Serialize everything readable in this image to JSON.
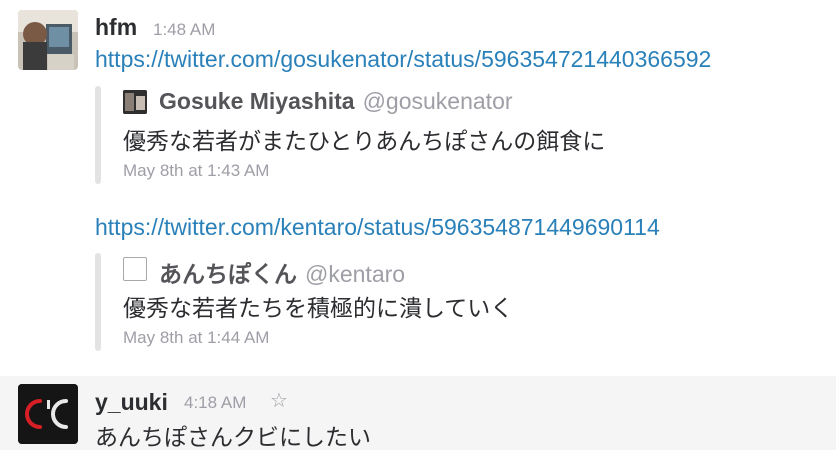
{
  "messages": [
    {
      "author": "hfm",
      "time": "1:48 AM",
      "links": [
        {
          "url": "https://twitter.com/gosukenator/status/596354721440366592",
          "attachment": {
            "author_name": "Gosuke Miyashita",
            "handle": "@gosukenator",
            "text": "優秀な若者がまたひとりあんちぽさんの餌食に",
            "timestamp": "May 8th at 1:43 AM",
            "icon": "user-avatar-icon"
          }
        },
        {
          "url": "https://twitter.com/kentaro/status/596354871449690114",
          "attachment": {
            "author_name": "あんちぽくん",
            "handle": "@kentaro",
            "text": "優秀な若者たちを積極的に潰していく",
            "timestamp": "May 8th at 1:44 AM",
            "icon": "blank-avatar-icon"
          }
        }
      ]
    },
    {
      "author": "y_uuki",
      "time": "4:18 AM",
      "star_icon": "star-icon",
      "text": "あんちぽさんクビにしたい"
    }
  ],
  "colors": {
    "link": "#2a80b9",
    "muted": "#9e9ea6",
    "attachment_bar": "#e3e3e3",
    "highlight_bg": "#f5f5f5"
  }
}
